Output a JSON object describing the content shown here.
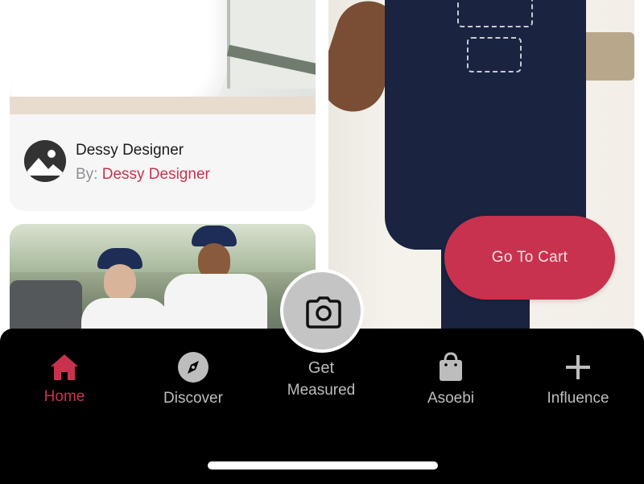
{
  "feed": {
    "designer_card": {
      "name": "Dessy Designer",
      "by_prefix": "By:",
      "by_link": "Dessy Designer"
    }
  },
  "actions": {
    "go_to_cart": "Go To Cart"
  },
  "tabbar": {
    "tabs": [
      {
        "label": "Home",
        "icon": "home-icon",
        "active": true
      },
      {
        "label": "Discover",
        "icon": "compass-icon",
        "active": false
      },
      {
        "label_line1": "Get",
        "label_line2": "Measured",
        "icon": "camera-icon",
        "active": false
      },
      {
        "label": "Asoebi",
        "icon": "shopping-bag-icon",
        "active": false
      },
      {
        "label": "Influence",
        "icon": "plus-icon",
        "active": false
      }
    ]
  },
  "colors": {
    "accent": "#c8324e",
    "tabbar_bg": "#000000",
    "inactive_tab": "#bdbdbd"
  }
}
